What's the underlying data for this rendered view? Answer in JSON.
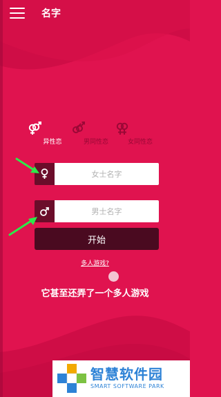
{
  "header": {
    "title": "名字",
    "menu_icon": "hamburger-menu-icon"
  },
  "tabs": [
    {
      "label": "异性恋",
      "icon": "hetero-icon",
      "active": true
    },
    {
      "label": "男同性恋",
      "icon": "gay-icon",
      "active": false
    },
    {
      "label": "女同性恋",
      "icon": "lesbian-icon",
      "active": false
    }
  ],
  "form": {
    "female_placeholder": "女士名字",
    "female_value": "",
    "male_placeholder": "男士名字",
    "male_value": "",
    "start_label": "开始"
  },
  "multiplayer": {
    "link_label": "多人游戏?",
    "headline": "它甚至还弄了一个多人游戏"
  },
  "watermark": {
    "cn": "智慧软件园",
    "en": "SMART SOFTWARE PARK"
  },
  "colors": {
    "primary": "#e0134f",
    "dark": "#4a0a20",
    "icon_bg": "#6b0d2a",
    "arrow": "#2ee84a",
    "watermark": "#2d82d6"
  }
}
